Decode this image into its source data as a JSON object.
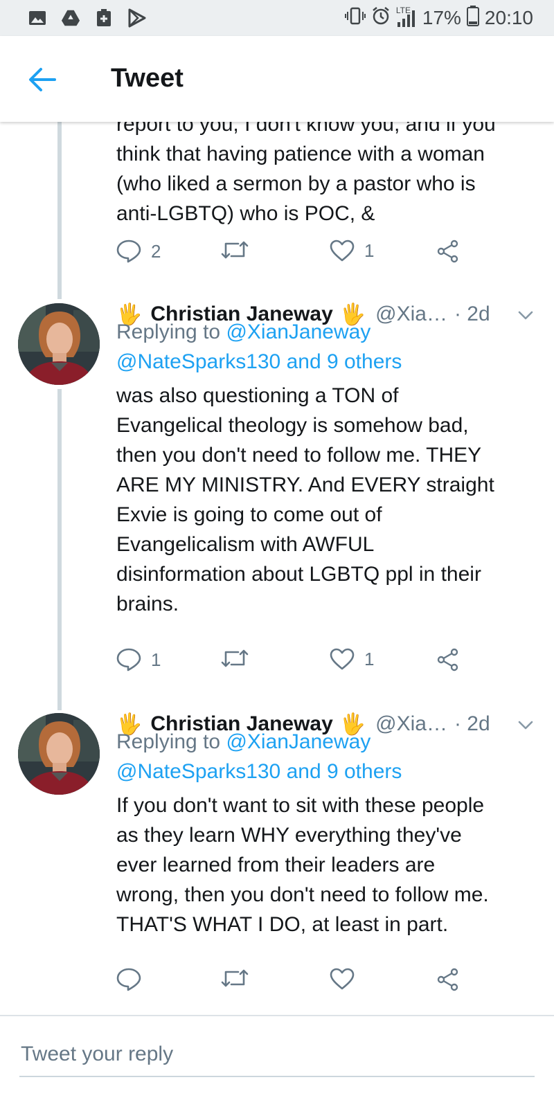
{
  "status_bar": {
    "left_icons": [
      "image-icon",
      "drive-icon",
      "clipboard-icon",
      "play-store-icon"
    ],
    "network": "LTE",
    "battery": "17%",
    "time": "20:10"
  },
  "header": {
    "title": "Tweet"
  },
  "partial_tweet": {
    "text_lines": [
      "report to you, I don't know you, and if you",
      "think that having patience with a woman",
      "(who liked a sermon by a pastor who is",
      "anti-LGBTQ) who is POC, &"
    ],
    "reply_count": "2",
    "retweet_count": "",
    "like_count": "1"
  },
  "tweets": [
    {
      "name": "Christian Janeway",
      "handle": "@Xia…",
      "time": "· 2d",
      "replying_prefix": "Replying to ",
      "replying_to_1": "@XianJaneway",
      "replying_to_2": "@NateSparks130 and 9 others",
      "body_lines": [
        "was also questioning a TON of",
        "Evangelical theology is somehow bad,",
        "then you don't need to follow me. THEY",
        "ARE MY MINISTRY. And EVERY straight",
        "Exvie is going to come out of",
        "Evangelicalism with AWFUL",
        "disinformation about LGBTQ ppl in their",
        "brains."
      ],
      "reply_count": "1",
      "retweet_count": "",
      "like_count": "1"
    },
    {
      "name": "Christian Janeway",
      "handle": "@Xia…",
      "time": "· 2d",
      "replying_prefix": "Replying to ",
      "replying_to_1": "@XianJaneway",
      "replying_to_2": "@NateSparks130 and 9 others",
      "body_lines": [
        "If you don't want to sit with these people",
        "as they learn WHY everything they've",
        "ever learned from their leaders are",
        "wrong, then you don't need to follow me.",
        "THAT'S WHAT I DO, at least in part."
      ],
      "reply_count": "",
      "retweet_count": "",
      "like_count": ""
    }
  ],
  "reply_box": {
    "placeholder": "Tweet your reply"
  },
  "colors": {
    "accent": "#1da1f2",
    "muted": "#657786",
    "text": "#14171a",
    "thread_line": "#cfd9de"
  }
}
